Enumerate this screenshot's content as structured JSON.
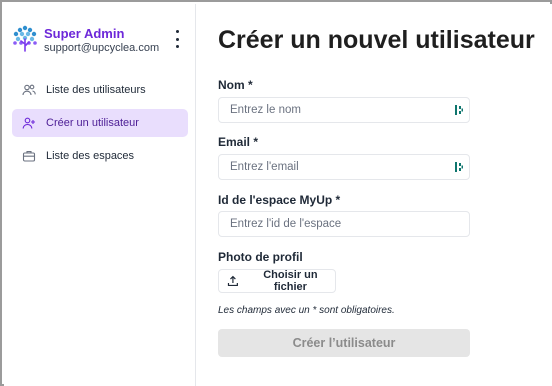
{
  "sidebar": {
    "profile": {
      "name": "Super Admin",
      "email": "support@upcyclea.com"
    },
    "nav": [
      {
        "label": "Liste des utilisateurs",
        "icon": "users-icon",
        "active": false
      },
      {
        "label": "Créer un utilisateur",
        "icon": "user-plus-icon",
        "active": true
      },
      {
        "label": "Liste des espaces",
        "icon": "briefcase-icon",
        "active": false
      }
    ]
  },
  "main": {
    "title": "Créer un nouvel utilisateur",
    "fields": {
      "name": {
        "label": "Nom *",
        "placeholder": "Entrez le nom",
        "value": ""
      },
      "email": {
        "label": "Email *",
        "placeholder": "Entrez l'email",
        "value": ""
      },
      "space_id": {
        "label": "Id de l'espace MyUp *",
        "placeholder": "Entrez l'id de l'espace",
        "value": ""
      }
    },
    "photo": {
      "label": "Photo de profil",
      "button": "Choisir un fichier"
    },
    "required_note": "Les champs avec un * sont obligatoires.",
    "submit_label": "Créer l’utilisateur"
  },
  "colors": {
    "accent": "#6d28d9",
    "active_nav_bg": "#e9defd",
    "submit_disabled_bg": "#e5e5e5",
    "password_manager_icon": "#0f766e"
  }
}
